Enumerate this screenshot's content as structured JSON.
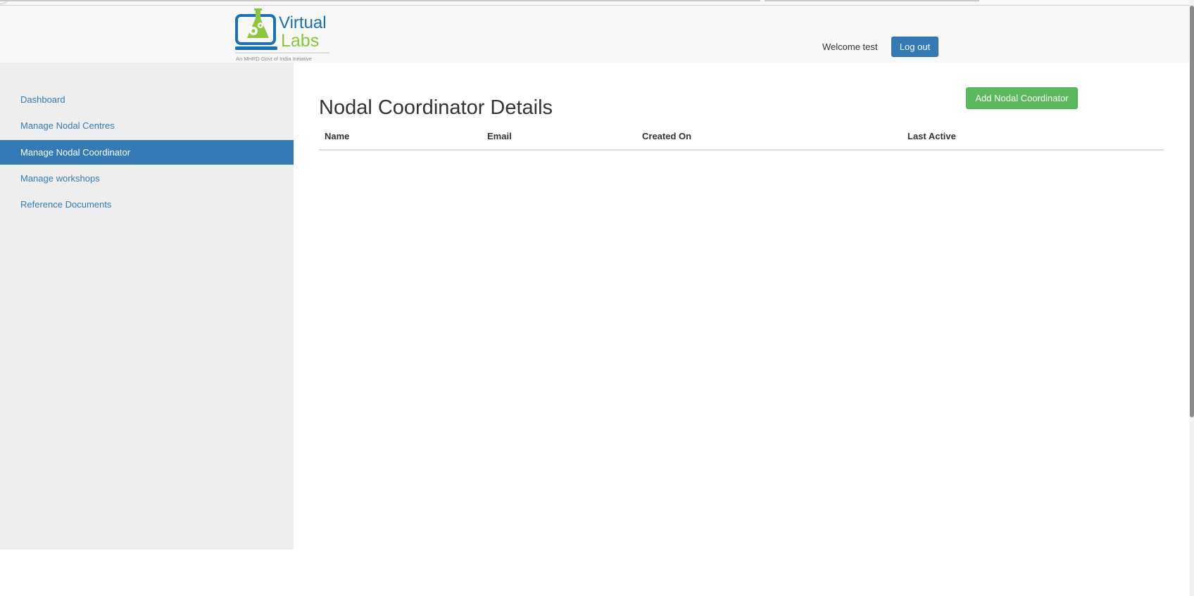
{
  "header": {
    "logo": {
      "word_top": "Virtual",
      "word_bottom": "Labs",
      "tagline": "An MHRD Govt of India Initiative"
    },
    "welcome_text": "Welcome test",
    "logout_label": "Log out"
  },
  "sidebar": {
    "items": [
      {
        "label": "Dashboard",
        "active": false
      },
      {
        "label": "Manage Nodal Centres",
        "active": false
      },
      {
        "label": "Manage Nodal Coordinator",
        "active": true
      },
      {
        "label": "Manage workshops",
        "active": false
      },
      {
        "label": "Reference Documents",
        "active": false
      }
    ]
  },
  "main": {
    "add_button_label": "Add Nodal Coordinator",
    "title": "Nodal Coordinator Details",
    "table": {
      "columns": [
        "Name",
        "Email",
        "Created On",
        "Last Active"
      ],
      "rows": []
    }
  },
  "colors": {
    "primary": "#337ab7",
    "success": "#5cb85c",
    "sidebar_bg": "#eeeeee",
    "header_bg": "#f8f8f8",
    "logo_blue": "#1a6fb5",
    "logo_green": "#8cc63f"
  }
}
